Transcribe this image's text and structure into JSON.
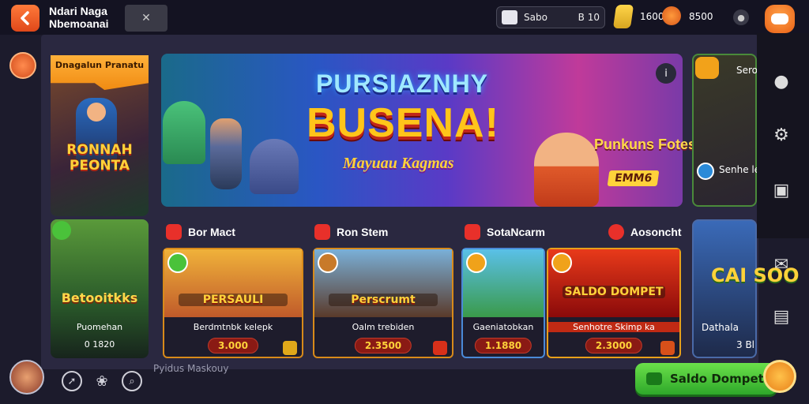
{
  "header": {
    "title_line1": "Ndari Naga",
    "title_line2": "Nbemoanai",
    "wallet_label": "Sabo",
    "wallet_value": "B 10",
    "coins": "1600",
    "score": "8500"
  },
  "featured": {
    "left_tag": "Dnagalun Pranatu",
    "left_title": "RONNAH PEONTA",
    "banner_line1": "PURSIAZNHY",
    "banner_line2": "BUSENA!",
    "banner_line3": "Mayuau Kagmas",
    "banner_side": "Punkuns Fotesuma",
    "banner_badge": "EMM6",
    "right_label": "Sero",
    "right_footer": "Senhe le"
  },
  "sections": [
    {
      "label": "Bor Mact"
    },
    {
      "label": "Ron Stem"
    },
    {
      "label": "SotaNcarm"
    },
    {
      "label": "Aosoncht"
    }
  ],
  "left_game": {
    "title": "Betooitkks",
    "subtitle": "Puomehan",
    "amount": "0 1820"
  },
  "games": [
    {
      "overlay": "PERSAULI",
      "title": "Berdmtnbk kelepk",
      "price": "3.000",
      "color": "#f08a1a"
    },
    {
      "overlay": "Perscrumt",
      "title": "Oalm trebiden",
      "price": "2.3500",
      "color": "#4aa8d8"
    },
    {
      "overlay": "",
      "title": "Gaeniatobkan",
      "price": "1.1880",
      "color": "#3ab86a"
    },
    {
      "overlay": "SALDO DOMPET",
      "title": "Senhotre Skimp ka",
      "price": "2.3000",
      "color": "#d8301a"
    }
  ],
  "right_game": {
    "title": "CAI SOO",
    "subtitle": "Dathala",
    "amount": "3 Bl"
  },
  "footer": {
    "online_text": "Pyidus Maskouy",
    "wallet_button": "Saldo Dompet"
  }
}
